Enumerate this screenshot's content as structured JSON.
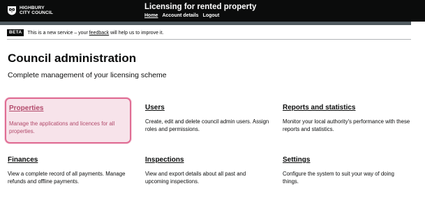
{
  "header": {
    "logo_lines": [
      "HIGHBURY",
      "CITY COUNCIL"
    ],
    "service_name": "Licensing for rented property",
    "nav": [
      {
        "label": "Home",
        "active": true
      },
      {
        "label": "Account details",
        "active": false
      },
      {
        "label": "Logout",
        "active": false
      }
    ]
  },
  "phase_banner": {
    "tag": "BETA",
    "text_before": "This is a new service – your ",
    "link": "feedback",
    "text_after": " will help us to improve it."
  },
  "page": {
    "title": "Council administration",
    "lede": "Complete management of your licensing scheme"
  },
  "cards": [
    {
      "title": "Properties",
      "description": "Manage the applications and licences for all properties.",
      "highlighted": true
    },
    {
      "title": "Users",
      "description": "Create, edit and delete council admin users. Assign roles and permissions.",
      "highlighted": false
    },
    {
      "title": "Reports and statistics",
      "description": "Monitor your local authority's performance with these reports and statistics.",
      "highlighted": false
    },
    {
      "title": "Finances",
      "description": "View a complete record of all payments. Manage refunds and offline payments.",
      "highlighted": false
    },
    {
      "title": "Inspections",
      "description": "View and export details about all past and upcoming inspections.",
      "highlighted": false
    },
    {
      "title": "Settings",
      "description": "Configure the system to suit your way of doing things.",
      "highlighted": false
    }
  ],
  "colors": {
    "header_bg": "#0b0c0c",
    "accent_bar": "#505a5f",
    "highlight_bg": "#f7e3ea",
    "highlight_border": "#e06d94"
  }
}
